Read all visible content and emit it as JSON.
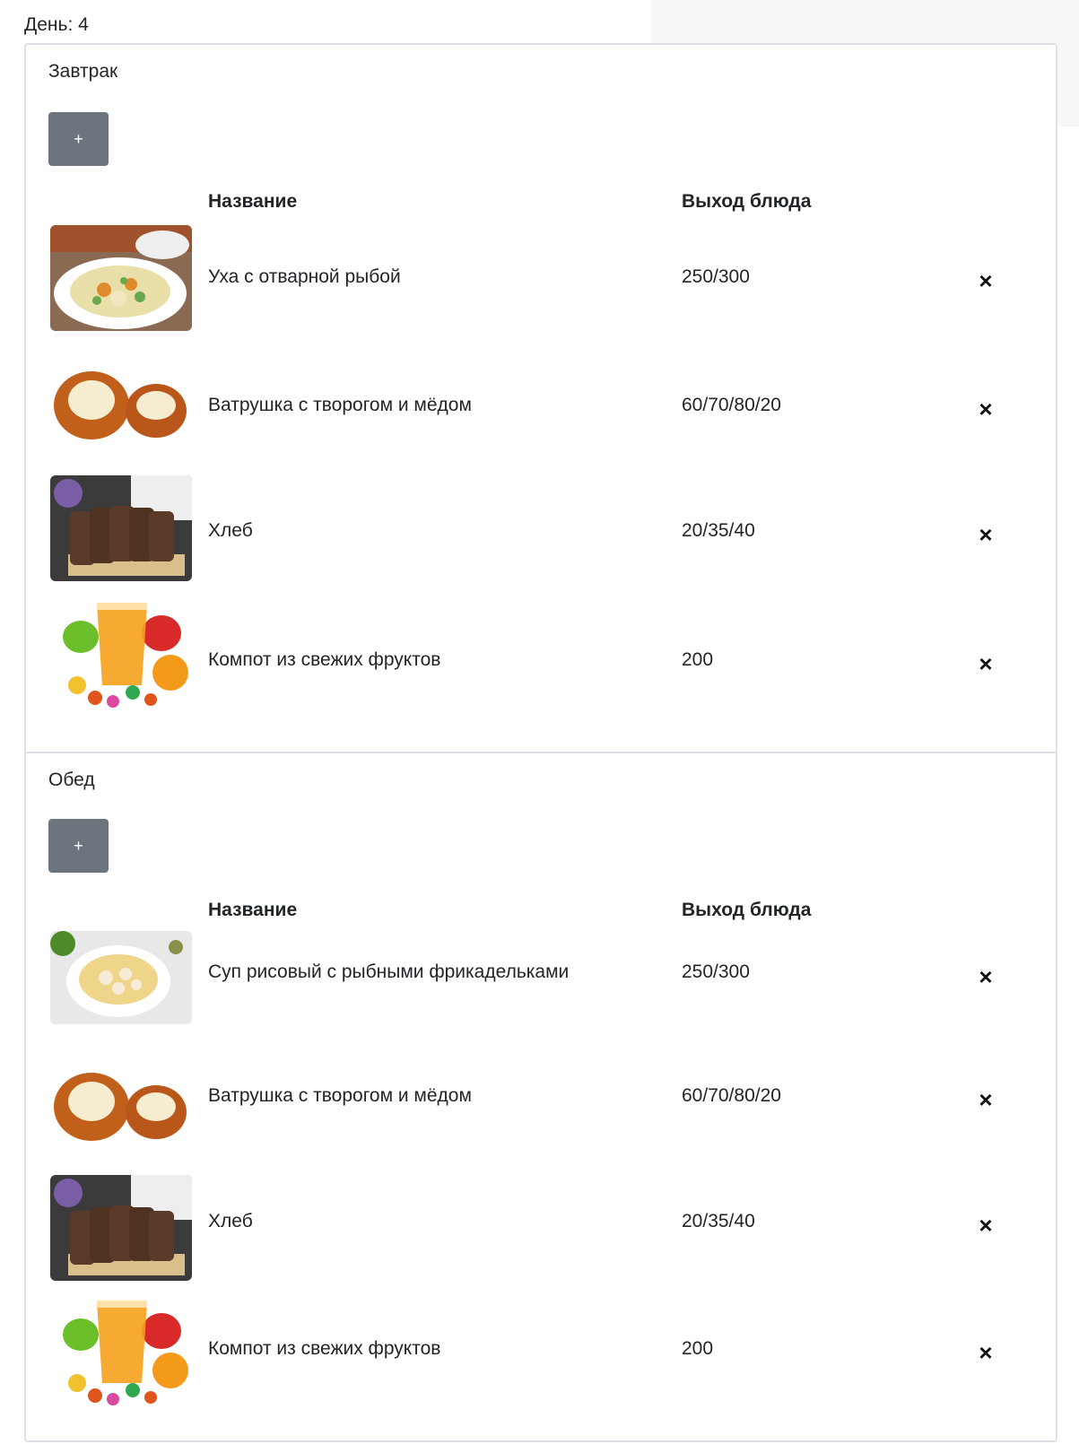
{
  "day": {
    "label": "День: 4"
  },
  "headers": {
    "name": "Название",
    "yield": "Выход блюда"
  },
  "add_label": "+",
  "remove_label": "×",
  "meals": [
    {
      "title": "Завтрак",
      "items": [
        {
          "name": "Уха с отварной рыбой",
          "yield": "250/300",
          "image": "fish-soup"
        },
        {
          "name": "Ватрушка с творогом и мёдом",
          "yield": "60/70/80/20",
          "image": "vatrushka"
        },
        {
          "name": "Хлеб",
          "yield": "20/35/40",
          "image": "bread"
        },
        {
          "name": "Компот из свежих фруктов",
          "yield": "200",
          "image": "compote"
        }
      ]
    },
    {
      "title": "Обед",
      "items": [
        {
          "name": "Суп рисовый с рыбными фрикадельками",
          "yield": "250/300",
          "image": "rice-soup"
        },
        {
          "name": "Ватрушка с творогом и мёдом",
          "yield": "60/70/80/20",
          "image": "vatrushka"
        },
        {
          "name": "Хлеб",
          "yield": "20/35/40",
          "image": "bread"
        },
        {
          "name": "Компот из свежих фруктов",
          "yield": "200",
          "image": "compote"
        }
      ]
    }
  ]
}
